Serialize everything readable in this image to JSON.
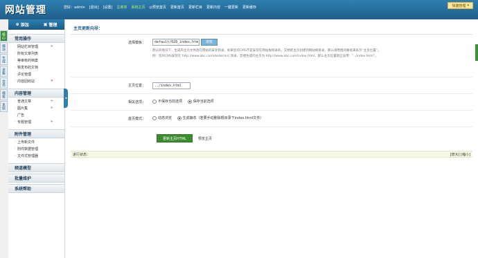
{
  "header": {
    "logo": "网站管理",
    "greeting": "您好：",
    "user": "admin",
    "logout": "[退出]",
    "settings": "[设置]",
    "links": [
      "左菜单",
      "系统主页",
      "预览首页",
      "更新首页",
      "更新栏目",
      "更新内容",
      "一键更新",
      "更新缓存"
    ],
    "quick_menu": "快捷管理"
  },
  "sidebar": {
    "add": "添加",
    "manage": "管理",
    "vtabs": [
      "核心",
      "模块",
      "生成",
      "采集",
      "会员",
      "模板",
      "系统"
    ],
    "sections": [
      {
        "title": "常用操作",
        "items": [
          {
            "label": "网站栏目管理",
            "mark": "+"
          },
          {
            "label": "所有文章列表",
            "mark": ""
          },
          {
            "label": "等审核的档案",
            "mark": ""
          },
          {
            "label": "我发布的文档",
            "mark": ""
          },
          {
            "label": "评论管理",
            "mark": ""
          },
          {
            "label": "内容回收站",
            "mark": "×"
          }
        ]
      },
      {
        "title": "内容管理",
        "items": [
          {
            "label": "普通文章",
            "mark": "+"
          },
          {
            "label": "图片集",
            "mark": "+"
          },
          {
            "label": "广告",
            "mark": ""
          },
          {
            "label": "专题管理",
            "mark": "+"
          }
        ]
      },
      {
        "title": "附件管理",
        "items": [
          {
            "label": "上传新文件",
            "mark": ""
          },
          {
            "label": "附件数据管理",
            "mark": ""
          },
          {
            "label": "文件式管理器",
            "mark": ""
          }
        ]
      },
      {
        "title": "频道模型",
        "items": []
      },
      {
        "title": "批量维护",
        "items": []
      },
      {
        "title": "系统帮助",
        "items": []
      }
    ]
  },
  "main": {
    "title": "主页更新向导：",
    "template_label": "选择模板：",
    "template_value": "default/028_index.htm",
    "browse": "浏览",
    "desc1": "默认的情况下，生成的主页文件放在网站的安装目录，如果您的CMS不是安装在网站根目录的，又想把主页创建到网站根目录，那么请用相对路径来表示“主页位置”。",
    "desc2": "例：您的CMS安装在 http://www.abc.com/dedecms/ 目录，您想生成的主页为 http://www.abc.com/index.html，那么主页位置就应该用：“../index.html”。",
    "position_label": "主页位置：",
    "position_value": "../index.html",
    "option_label": "相关选项：",
    "options": [
      "不保存当前选项",
      "保存当前选项"
    ],
    "mode_label": "首页模式：",
    "modes": [
      "动态浏览",
      "生成静态（若要手动删除根目录下index.html文件）"
    ],
    "update_btn": "更新主页HTML",
    "preview": "预览主页",
    "progress_label": "进行状态：",
    "progress_actions": "[增大] [缩小]"
  }
}
